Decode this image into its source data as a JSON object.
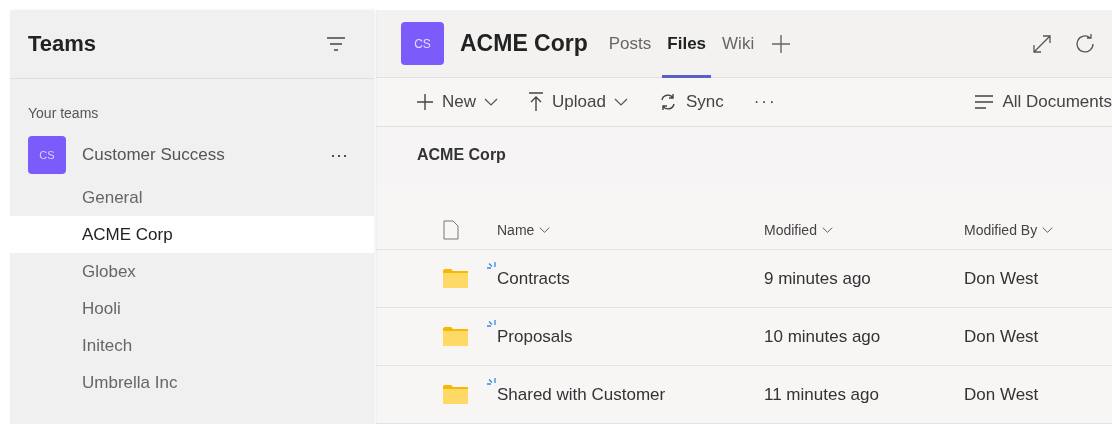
{
  "sidebar": {
    "title": "Teams",
    "section_label": "Your teams",
    "team": {
      "avatar": "CS",
      "name": "Customer Success",
      "more": "···"
    },
    "channels": [
      {
        "label": "General",
        "selected": false
      },
      {
        "label": "ACME Corp",
        "selected": true
      },
      {
        "label": "Globex",
        "selected": false
      },
      {
        "label": "Hooli",
        "selected": false
      },
      {
        "label": "Initech",
        "selected": false
      },
      {
        "label": "Umbrella Inc",
        "selected": false
      }
    ]
  },
  "header": {
    "avatar": "CS",
    "title": "ACME Corp",
    "tabs": [
      {
        "label": "Posts",
        "selected": false
      },
      {
        "label": "Files",
        "selected": true
      },
      {
        "label": "Wiki",
        "selected": false
      }
    ]
  },
  "toolbar": [
    {
      "kind": "new",
      "label": "New",
      "dropdown": true
    },
    {
      "kind": "upload",
      "label": "Upload",
      "dropdown": true
    },
    {
      "kind": "sync",
      "label": "Sync",
      "dropdown": false
    },
    {
      "kind": "more",
      "label": "···",
      "dropdown": false
    },
    {
      "kind": "view",
      "label": "All Documents",
      "dropdown": false
    }
  ],
  "breadcrumb": "ACME Corp",
  "table": {
    "columns": [
      "Name",
      "Modified",
      "Modified By"
    ],
    "rows": [
      {
        "kind": "folder",
        "is_new": true,
        "name": "Contracts",
        "modified": "9 minutes ago",
        "modified_by": "Don West"
      },
      {
        "kind": "folder",
        "is_new": true,
        "name": "Proposals",
        "modified": "10 minutes ago",
        "modified_by": "Don West"
      },
      {
        "kind": "folder",
        "is_new": true,
        "name": "Shared with Customer",
        "modified": "11 minutes ago",
        "modified_by": "Don West"
      }
    ]
  }
}
